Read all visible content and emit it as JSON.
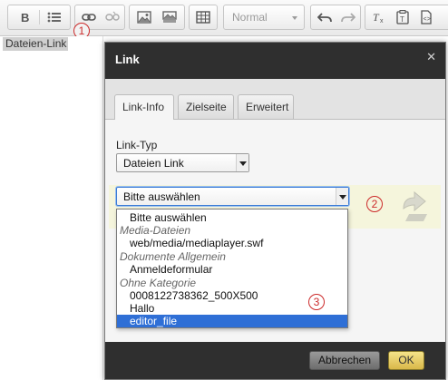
{
  "toolbar": {
    "format_label": "Normal",
    "annotation_1": "1"
  },
  "editor": {
    "selected_text": "Dateien-Link"
  },
  "dialog": {
    "title": "Link",
    "close_glyph": "✕",
    "tabs": [
      {
        "label": "Link-Info"
      },
      {
        "label": "Zielseite"
      },
      {
        "label": "Erweitert"
      }
    ],
    "link_type_label": "Link-Typ",
    "link_type_value": "Dateien Link",
    "file_select_value": "Bitte auswählen",
    "annotation_2": "2",
    "annotation_3": "3",
    "dropdown": {
      "items": [
        {
          "kind": "option",
          "label": "Bitte auswählen"
        },
        {
          "kind": "group",
          "label": "Media-Dateien"
        },
        {
          "kind": "option",
          "label": "web/media/mediaplayer.swf"
        },
        {
          "kind": "group",
          "label": "Dokumente Allgemein"
        },
        {
          "kind": "option",
          "label": "Anmeldeformular"
        },
        {
          "kind": "group",
          "label": "Ohne Kategorie"
        },
        {
          "kind": "option",
          "label": "0008122738362_500X500"
        },
        {
          "kind": "option",
          "label": "Hallo"
        },
        {
          "kind": "option",
          "label": "editor_file",
          "selected": true
        }
      ]
    },
    "buttons": {
      "cancel": "Abbrechen",
      "ok": "OK"
    }
  },
  "colors": {
    "dialog_header": "#2f2f2f",
    "selection_highlight": "#2f6fd6",
    "annotation_red": "#cc2a2a",
    "ok_button": "#e8cf6a",
    "yellow_area": "#f5f5dc"
  }
}
